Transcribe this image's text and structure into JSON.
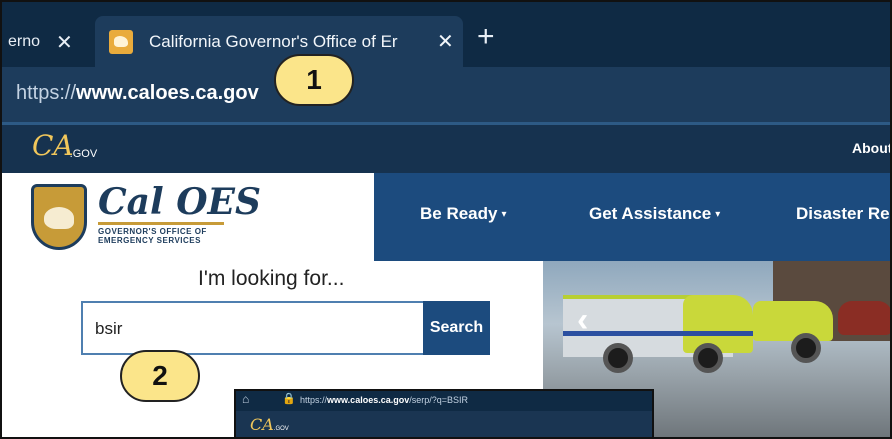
{
  "browser": {
    "prev_tab": {
      "label": "erno"
    },
    "active_tab": {
      "title": "California Governor's Office of Er"
    },
    "close_glyph": "✕",
    "new_tab_glyph": "+",
    "address": {
      "prefix": "https://",
      "host": "www.caloes.ca.gov"
    }
  },
  "callouts": {
    "one": "1",
    "two": "2"
  },
  "site": {
    "cagov_logo": "CA",
    "cagov_suffix": ".GOV",
    "top_link": "About",
    "brand_name": "Cal OES",
    "brand_sub": "GOVERNOR'S OFFICE OF EMERGENCY SERVICES",
    "nav": [
      {
        "label": "Be Ready"
      },
      {
        "label": "Get Assistance"
      },
      {
        "label": "Disaster Resp"
      }
    ],
    "caret": "▾",
    "search": {
      "heading": "I'm looking for...",
      "value": "bsir",
      "button": "Search"
    },
    "carousel_prev": "‹"
  },
  "inset": {
    "home_icon": "⌂",
    "lock_icon": "🔒",
    "url_prefix": "https://",
    "url_host": "www.caloes.ca.gov",
    "url_path": "/serp/?q=BSIR",
    "logo": "CA",
    "logo_suffix": ".GOV"
  },
  "colors": {
    "tabstrip": "#0f2a44",
    "address_bar": "#1d3c5c",
    "nav_blue": "#1c4b7e",
    "callout_yellow": "#fbe58a",
    "gold": "#c79b38"
  }
}
